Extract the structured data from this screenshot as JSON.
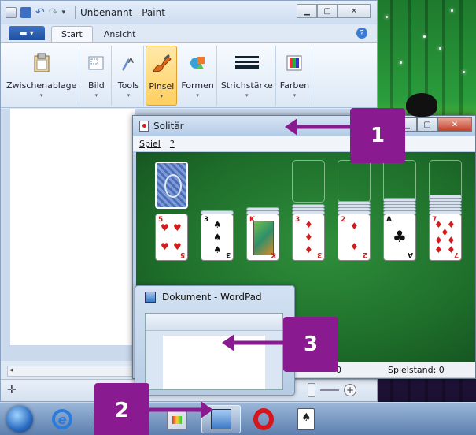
{
  "paint": {
    "title": "Unbenannt - Paint",
    "tabs": [
      "Start",
      "Ansicht"
    ],
    "groups": [
      {
        "label": "Zwischenablage",
        "icon": "clipboard-icon"
      },
      {
        "label": "Bild",
        "icon": "image-icon"
      },
      {
        "label": "Tools",
        "icon": "tools-icon"
      },
      {
        "label": "Pinsel",
        "icon": "brush-icon"
      },
      {
        "label": "Formen",
        "icon": "shapes-icon"
      },
      {
        "label": "Strichstärke",
        "icon": "line-width-icon"
      },
      {
        "label": "Farben",
        "icon": "colors-icon"
      }
    ]
  },
  "solitaire": {
    "title": "Solitär",
    "menu": [
      "Spiel",
      "?"
    ],
    "status_left": "0",
    "status_right": "Spielstand: 0"
  },
  "wordpad_thumb": {
    "title": "Dokument - WordPad"
  },
  "callouts": [
    "1",
    "2",
    "3"
  ],
  "colors": {
    "callout": "#8a1a8f",
    "felt": "#1e6e2a",
    "selected_group": "#ffcf60"
  }
}
